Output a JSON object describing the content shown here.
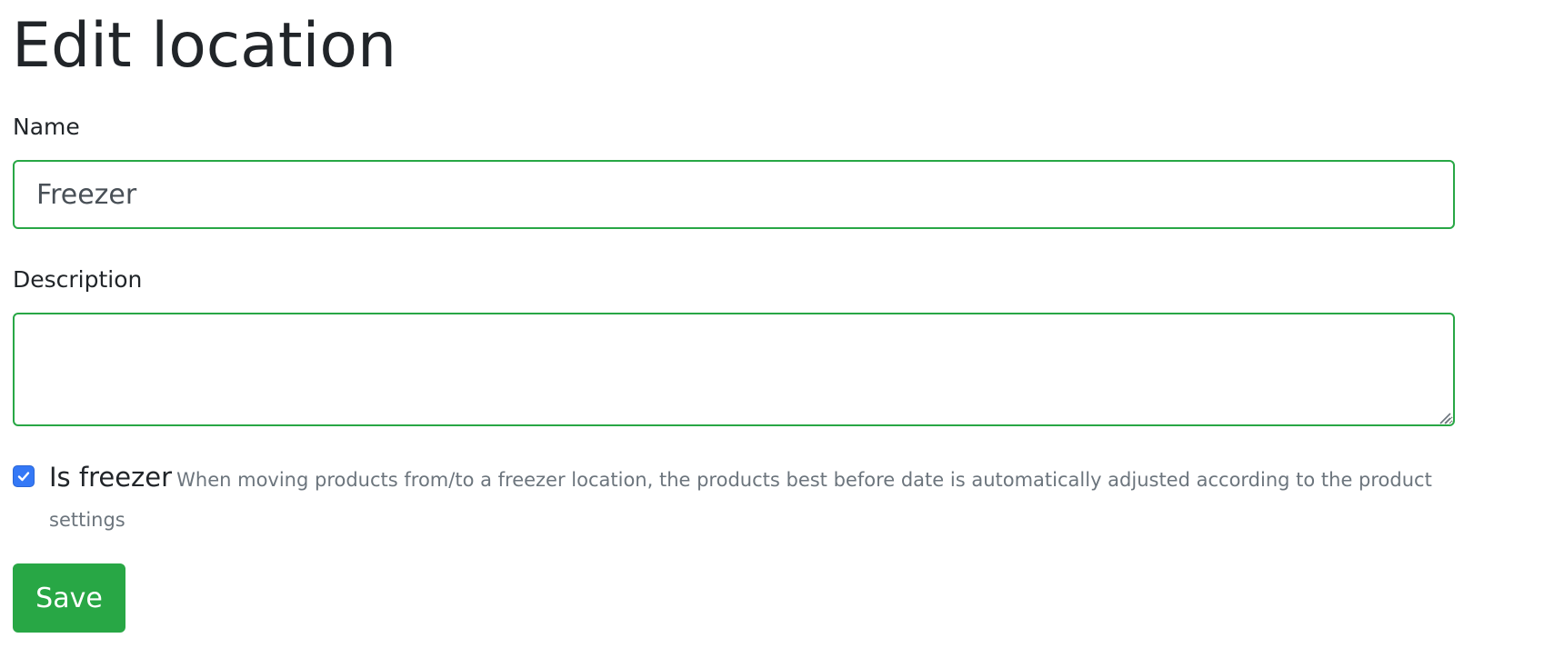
{
  "page": {
    "title": "Edit location"
  },
  "form": {
    "name": {
      "label": "Name",
      "value": "Freezer"
    },
    "description": {
      "label": "Description",
      "value": ""
    },
    "is_freezer": {
      "label": "Is freezer",
      "checked": true,
      "help": "When moving products from/to a freezer location, the products best before date is automatically adjusted according to the product settings"
    },
    "save_label": "Save"
  },
  "colors": {
    "accent": "#28a745",
    "checkbox": "#3478f6",
    "text": "#212529",
    "muted": "#6c757d"
  },
  "icons": {
    "checkbox": "check-icon",
    "resize": "resize-grip-icon"
  }
}
